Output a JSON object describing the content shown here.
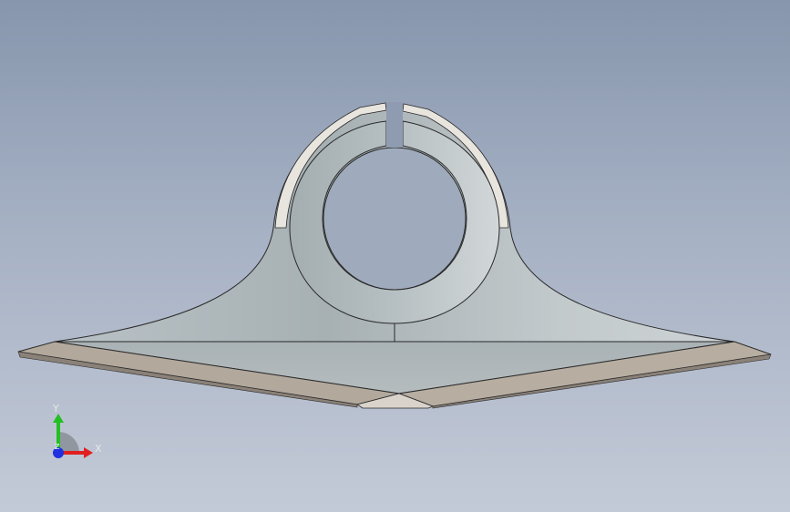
{
  "viewport": {
    "background_top": "#8796ad",
    "background_bottom": "#c3cad7"
  },
  "model": {
    "icon": "3d-part-model",
    "face_color": "#b9c0c3",
    "edge_face_color": "#b2a89c"
  },
  "triad": {
    "x_label": "X",
    "y_label": "Y",
    "z_label": "Z",
    "x_color": "#e02020",
    "y_color": "#22c022",
    "z_color": "#2030e0"
  }
}
